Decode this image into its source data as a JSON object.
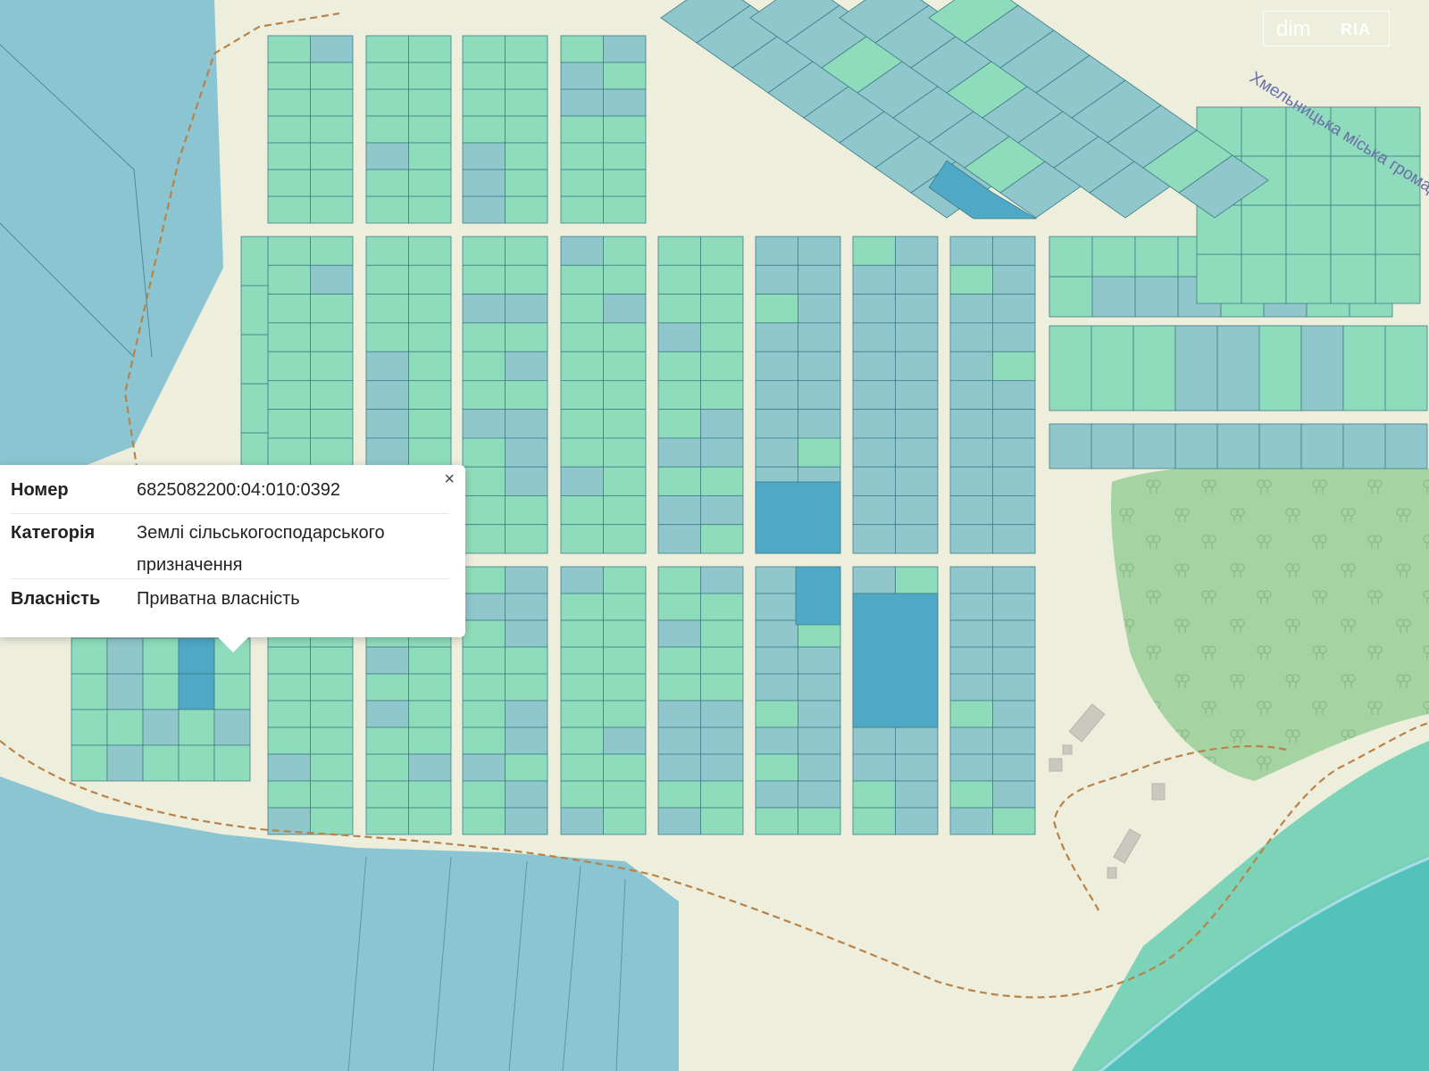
{
  "map": {
    "area_label": "Хмельницька міська громада",
    "colors": {
      "background": "#eeeedd",
      "road": "#f4f2d8",
      "field_blue": "#8cc5d2",
      "plot_green": "#8fdcbc",
      "plot_blue": "#8fc7cd",
      "plot_dark": "#4fa8c6",
      "forest": "#a6d3a2",
      "water": "#52c2bb",
      "boundary": "#b8834a"
    }
  },
  "popup": {
    "close_label": "×",
    "rows": [
      {
        "key": "Номер",
        "value": "6825082200:04:010:0392"
      },
      {
        "key": "Категорія",
        "value": "Землі сільськогосподарського призначення"
      },
      {
        "key": "Власність",
        "value": "Приватна власність"
      }
    ]
  },
  "watermark": {
    "text": "dim",
    "brand": "RIA"
  }
}
